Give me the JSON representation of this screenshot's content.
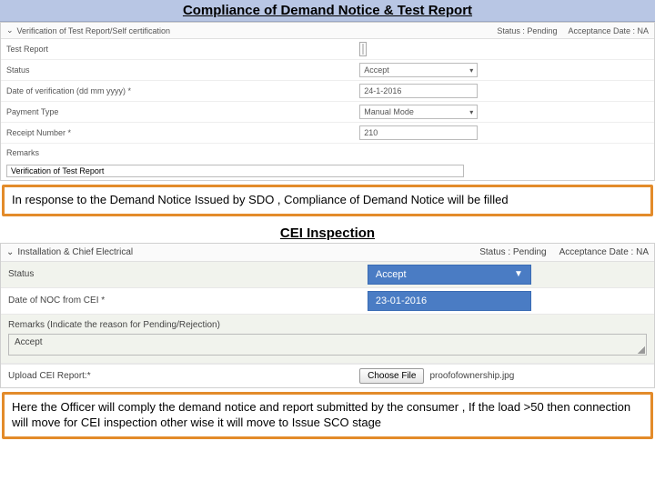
{
  "section1": {
    "title": "Compliance of Demand Notice & Test Report",
    "panel": {
      "header_title": "Verification of Test Report/Self certification",
      "status_label": "Status  :  Pending",
      "acceptance_label": "Acceptance Date :  NA"
    },
    "rows": {
      "test_report_label": "Test Report",
      "status_label": "Status",
      "status_value": "Accept",
      "date_label": "Date of verification (dd mm yyyy) *",
      "date_value": "24-1-2016",
      "payment_label": "Payment Type",
      "payment_value": "Manual Mode",
      "receipt_label": "Receipt Number *",
      "receipt_value": "210",
      "remarks_label": "Remarks",
      "final_label": "Verification of Test Report"
    },
    "callout": "In response to the Demand Notice Issued by SDO , Compliance of Demand Notice will be filled"
  },
  "section2": {
    "title": "CEI Inspection",
    "panel": {
      "header_title": "Installation & Chief Electrical",
      "status_label": "Status  :  Pending",
      "acceptance_label": "Acceptance Date :  NA"
    },
    "rows": {
      "status_label": "Status",
      "status_value": "Accept",
      "date_label": "Date of NOC from CEI *",
      "date_value": "23-01-2016",
      "remarks_label": "Remarks (Indicate the reason for Pending/Rejection)",
      "remarks_value": "Accept",
      "upload_label": "Upload CEI Report:*",
      "choose_btn": "Choose File",
      "file_name": "proofofownership.jpg"
    },
    "callout": "Here the Officer will comply the demand notice and report submitted by the consumer , If the load >50 then connection will move for CEI inspection other wise it will move to  Issue SCO   stage"
  }
}
